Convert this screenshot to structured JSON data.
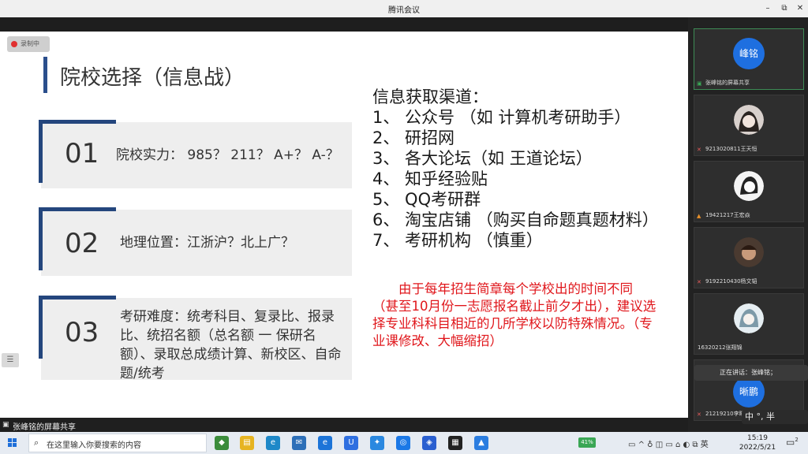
{
  "window": {
    "title": "腾讯会议",
    "minimize": "–",
    "restore": "⧉",
    "close": "✕"
  },
  "recording": {
    "label": "录制中"
  },
  "slide": {
    "title": "院校选择（信息战）",
    "cards": [
      {
        "num": "01",
        "text": "院校实力：  985？  211？  A+？  A-？"
      },
      {
        "num": "02",
        "text": "地理位置：江浙沪？北上广？"
      },
      {
        "num": "03",
        "text": "考研难度：统考科目、复录比、报录比、统招名额（总名额 一 保研名额）、录取总成绩计算、新校区、自命题/统考"
      }
    ],
    "info_heading": "信息获取渠道：",
    "info_items": [
      "1、 公众号 （如 计算机考研助手）",
      "2、 研招网",
      "3、 各大论坛（如 王道论坛）",
      "4、 知乎经验贴",
      "5、 QQ考研群",
      "6、 淘宝店铺 （购买自命题真题材料）",
      "7、 考研机构 （慎重）"
    ],
    "note": "由于每年招生简章每个学校出的时间不同（甚至10月份一志愿报名截止前夕才出），建议选择专业科科目相近的几所学校以防特殊情况。（专业课修改、大幅缩招）",
    "side_handle": "☰"
  },
  "sharebar": {
    "label": "张峰铭的屏幕共享"
  },
  "participants": [
    {
      "avatar_text": "峰铭",
      "name": "张峰铭的屏幕共享",
      "active": true
    },
    {
      "avatar_text": "",
      "name": "9213020811王天恒",
      "active": false
    },
    {
      "avatar_text": "",
      "name": "19421217王宏焱",
      "active": false
    },
    {
      "avatar_text": "",
      "name": "9192210430杨文韬",
      "active": false
    },
    {
      "avatar_text": "",
      "name": "16320212张翔锦",
      "active": false
    },
    {
      "avatar_text": "晰鹏",
      "name": "21219210李晰鹏",
      "active": false
    }
  ],
  "speaking": "正在讲话：张峰铭；",
  "ime": "中 °, 半",
  "taskbar": {
    "search_placeholder": "在这里输入你要搜索的内容",
    "battery": "41%",
    "tray": "▭  ^  ♁  ◫  ▭  ⌂  ◐  ⧉  英",
    "time": "15:19",
    "date": "2022/5/21",
    "notifications": "2"
  },
  "colors": {
    "accent": "#24467d",
    "note_red": "#e0161b",
    "meeting_blue": "#1e6fe0"
  }
}
